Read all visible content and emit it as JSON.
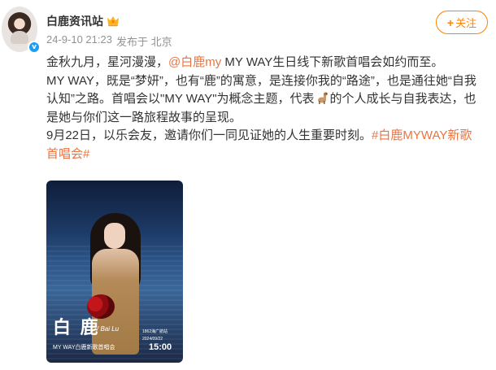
{
  "user": {
    "name": "白鹿资讯站",
    "badge_icon": "crown-icon",
    "verified_icon": "verified-icon",
    "verified_mark": "v"
  },
  "meta": {
    "timestamp": "24-9-10 21:23",
    "source": "发布于 北京"
  },
  "follow": {
    "plus": "+",
    "label": "关注",
    "color": "#ff8200"
  },
  "post": {
    "link_color": "#eb7340",
    "l1_a": "金秋九月，星河漫漫，",
    "l1_mention": "@白鹿my",
    "l1_b": " MY WAY生日线下新歌首唱会如约而至。",
    "l2": "MY WAY，既是“梦妍”，也有“鹿”的寓意，是连接你我的“路途”，也是通往她“自我",
    "l3_a": "认知”之路。首唱会以\"MY WAY\"为概念主题，代表",
    "l3_icon": "alpaca-emoji-icon",
    "l3_b": "的个人成长与自我表达，也",
    "l4": "是她与你们这一路旅程故事的呈现。",
    "l5_a": "9月22日，以乐会友，邀请你们一同见证她的人生重要时刻。",
    "l5_tag": "#白鹿MYWAY新歌",
    "l6_tag": "首唱会#"
  },
  "poster": {
    "name": "白 鹿",
    "name_en": "/ Bai Lu",
    "venue": "1862海广航站",
    "date": "2024/09/22",
    "title": "MY WAY白鹿新歌首唱会",
    "time": "15:00"
  }
}
